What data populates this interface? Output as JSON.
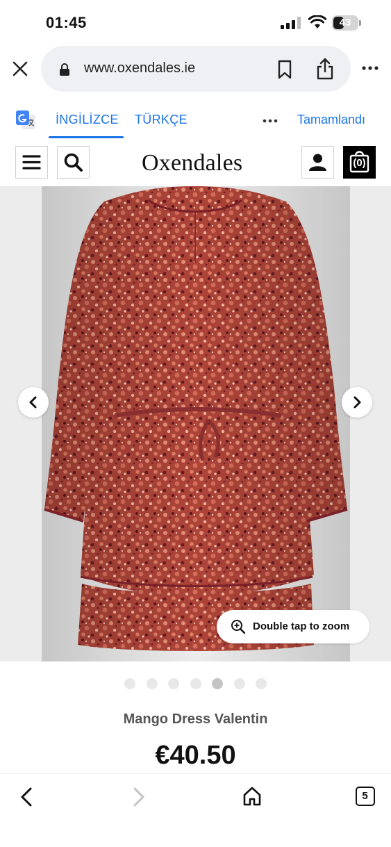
{
  "status_bar": {
    "time": "01:45",
    "battery_level": "43",
    "battery_fraction": 0.43
  },
  "browser": {
    "url": "www.oxendales.ie"
  },
  "translate_bar": {
    "lang_english": "İNGİLİZCE",
    "lang_turkish": "TÜRKÇE",
    "done": "Tamamlandı"
  },
  "site_header": {
    "brand": "Oxendales",
    "bag_count": "(0)"
  },
  "gallery": {
    "zoom_hint": "Double tap to zoom",
    "dot_count": 7,
    "active_dot": 4
  },
  "product": {
    "name": "Mango Dress Valentin",
    "price": "€40.50"
  },
  "toolbar": {
    "tab_count": "5"
  },
  "colors": {
    "accent_blue": "#1a73e8",
    "dress_base": "#b14a3e",
    "image_bg": "#ececec"
  }
}
